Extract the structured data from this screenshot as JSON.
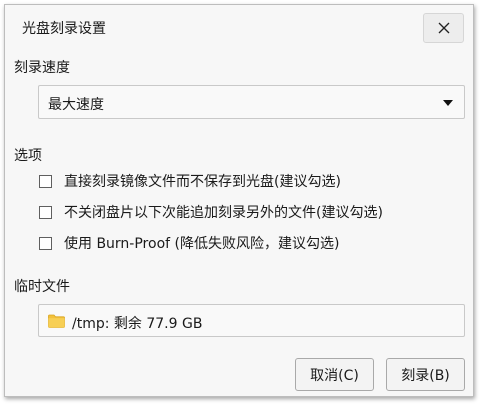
{
  "window": {
    "title": "光盘刻录设置",
    "close_icon": "close-icon"
  },
  "speed": {
    "section_label": "刻录速度",
    "selected": "最大速度"
  },
  "options": {
    "section_label": "选项",
    "items": [
      {
        "label": "直接刻录镜像文件而不保存到光盘(建议勾选)",
        "checked": false
      },
      {
        "label": "不关闭盘片以下次能追加刻录另外的文件(建议勾选)",
        "checked": false
      },
      {
        "label": "使用 Burn-Proof (降低失败风险，建议勾选)",
        "checked": false
      }
    ]
  },
  "temp": {
    "section_label": "临时文件",
    "path": "/tmp: 剩余 77.9 GB",
    "folder_icon": "folder-icon",
    "folder_color": "#f3c13a"
  },
  "buttons": {
    "cancel": "取消(C)",
    "burn": "刻录(B)"
  }
}
